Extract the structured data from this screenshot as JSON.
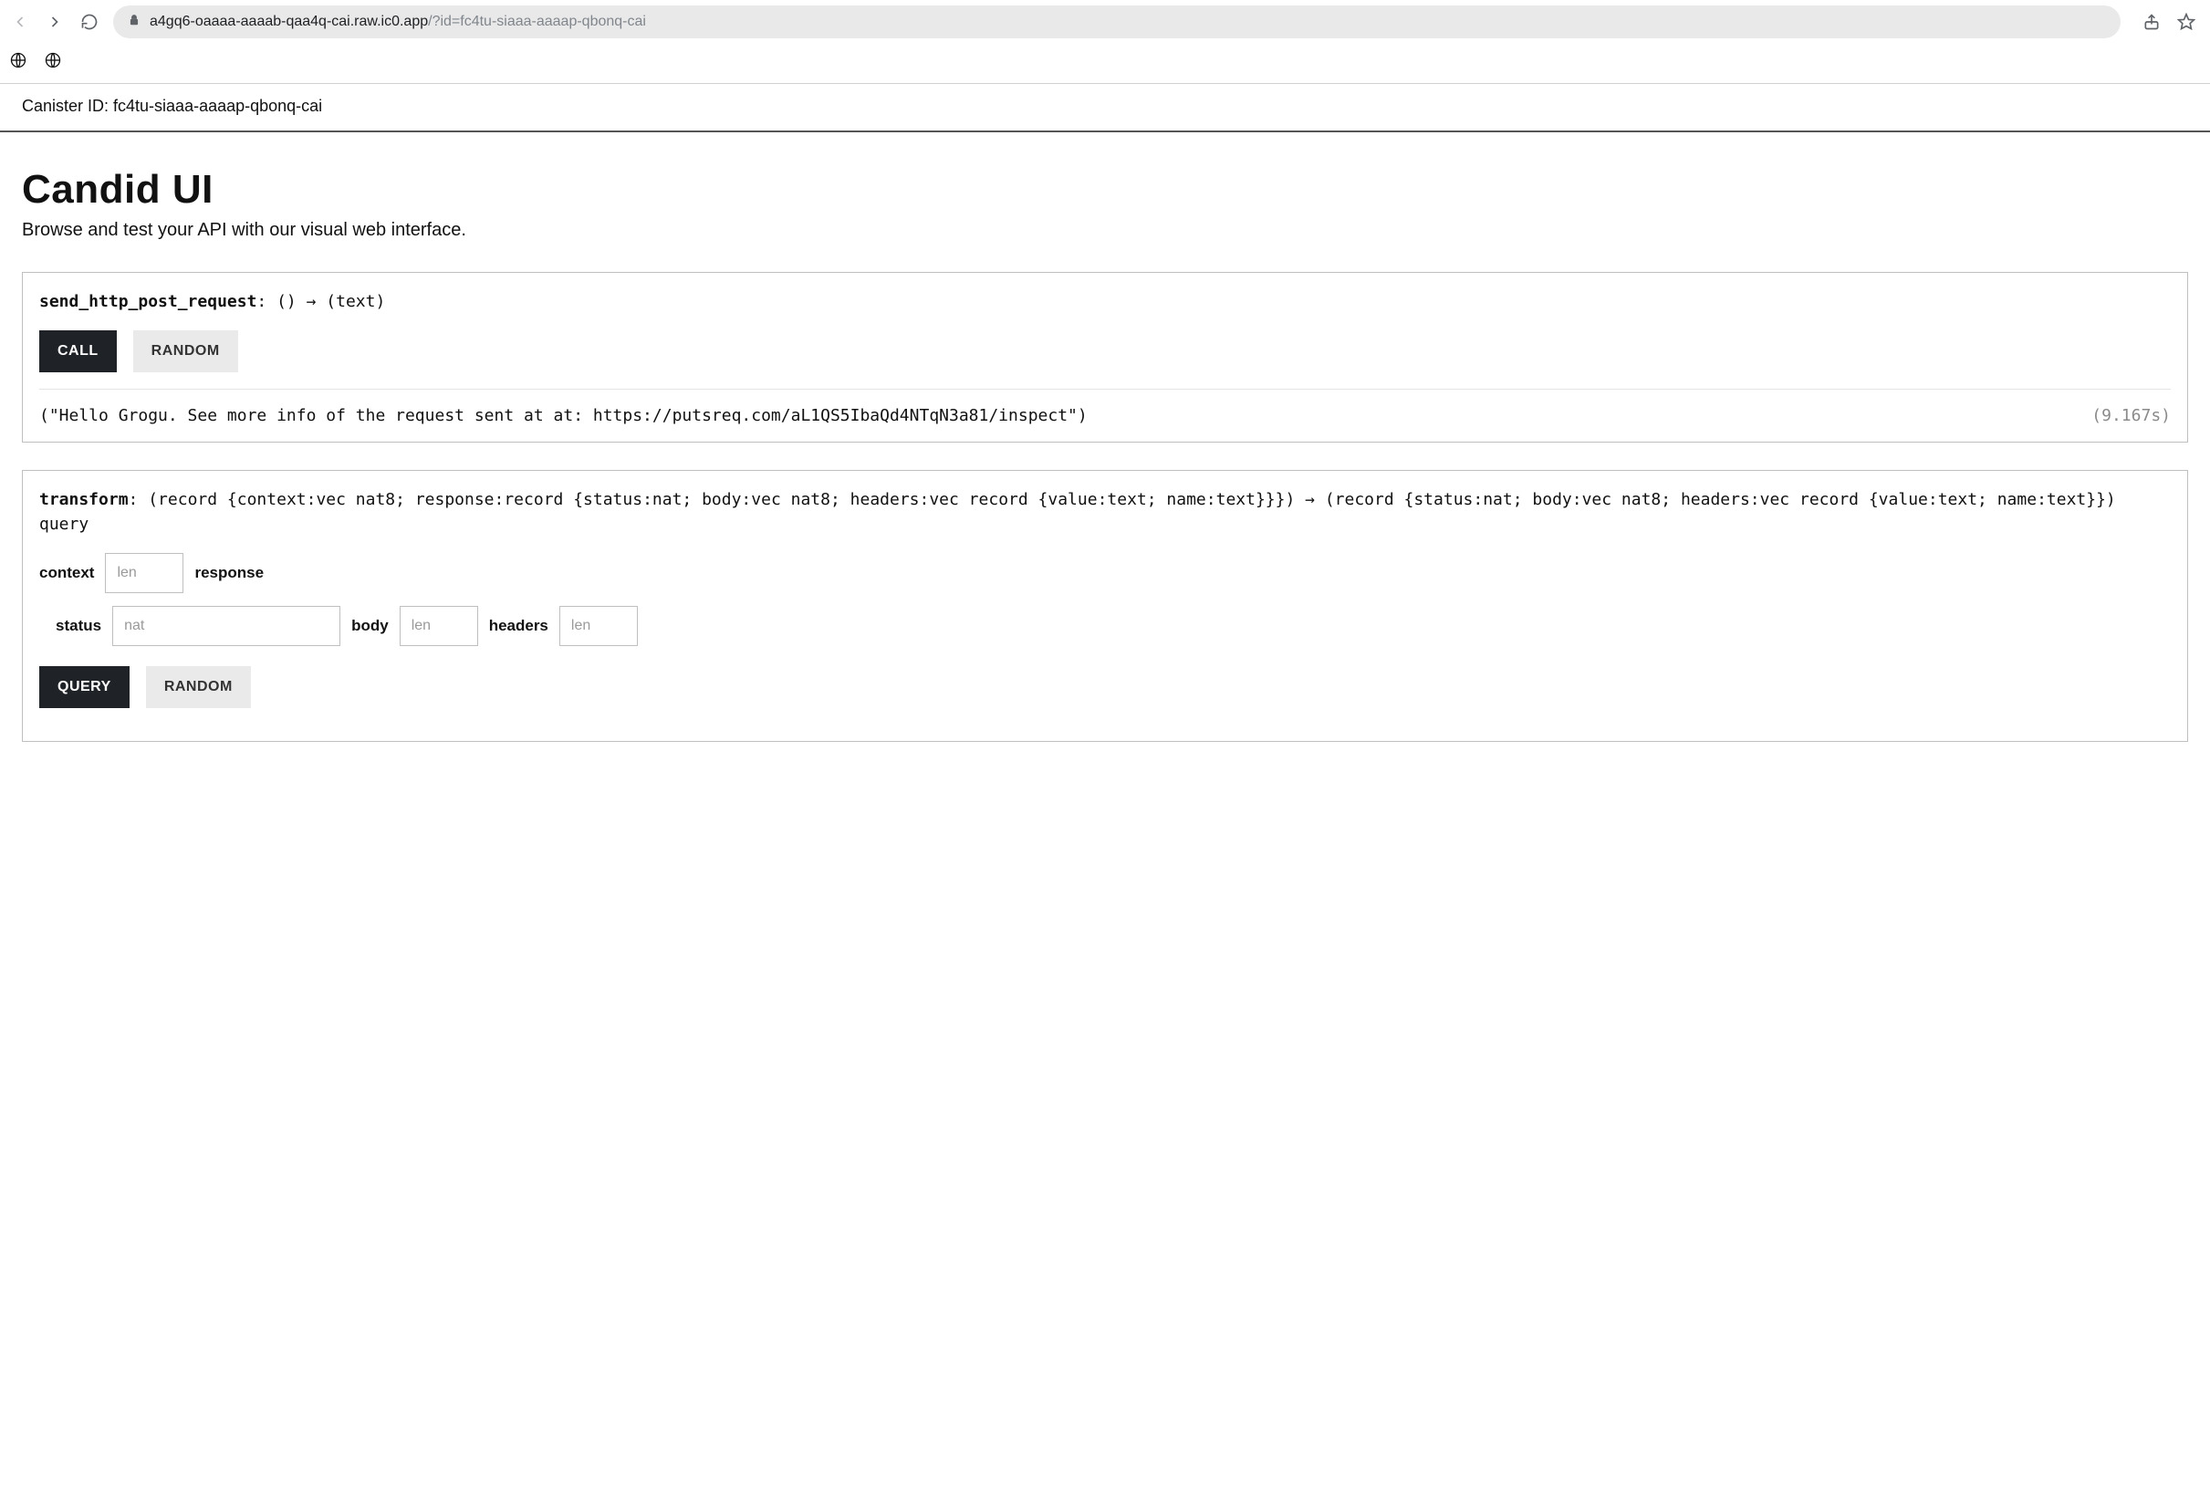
{
  "browser": {
    "url_host": "a4gq6-oaaaa-aaaab-qaa4q-cai.raw.ic0.app",
    "url_query": "/?id=fc4tu-siaaa-aaaap-qbonq-cai"
  },
  "canister": {
    "label": "Canister ID: ",
    "id": "fc4tu-siaaa-aaaap-qbonq-cai"
  },
  "header": {
    "title": "Candid UI",
    "subtitle": "Browse and test your API with our visual web interface."
  },
  "methods": [
    {
      "name": "send_http_post_request",
      "signature_tail": ": () → (text)",
      "buttons": {
        "primary": "CALL",
        "secondary": "RANDOM"
      },
      "result_text": "(\"Hello Grogu. See more info of the request sent at at: https://putsreq.com/aL1QS5IbaQd4NTqN3a81/inspect\")",
      "result_time": "(9.167s)"
    },
    {
      "name": "transform",
      "signature_tail": ": (record {context:vec nat8; response:record {status:nat; body:vec nat8; headers:vec record {value:text; name:text}}}) → (record {status:nat; body:vec nat8; headers:vec record {value:text; name:text}}) query",
      "buttons": {
        "primary": "QUERY",
        "secondary": "RANDOM"
      },
      "fields": {
        "context_label": "context",
        "context_placeholder": "len",
        "response_label": "response",
        "status_label": "status",
        "status_placeholder": "nat",
        "body_label": "body",
        "body_placeholder": "len",
        "headers_label": "headers",
        "headers_placeholder": "len"
      }
    }
  ]
}
